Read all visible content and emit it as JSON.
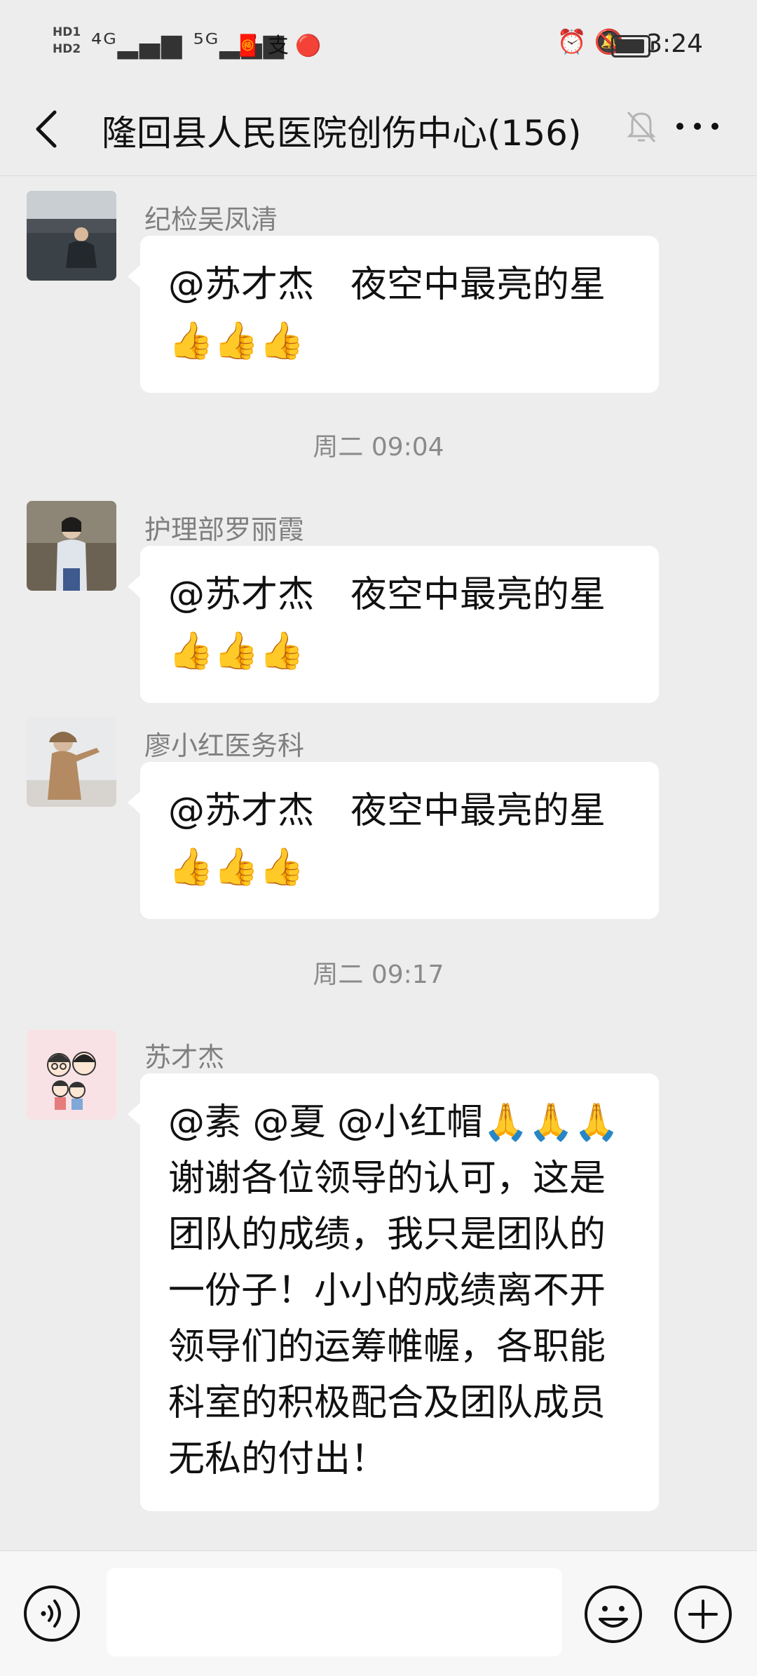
{
  "status_bar": {
    "hd_label": "HD1\nHD2",
    "signal_text": "⁴ᴳ▂▄▆ ⁵ᴳ▂▄▆ ◠",
    "app_icons": "🧧 支 🔴",
    "right_icons": "⏰ 🔕",
    "time": "3:24"
  },
  "header": {
    "title": "隆回县人民医院创伤中心(156)",
    "back_icon": "chevron-left",
    "mute_icon": "bell-off",
    "more_icon": "ellipsis"
  },
  "messages": [
    {
      "sender": "纪检吴凤清",
      "text": "@苏才杰　夜空中最亮的星👍👍👍"
    },
    {
      "timestamp": "周二 09:04"
    },
    {
      "sender": "护理部罗丽霞",
      "text": "@苏才杰　夜空中最亮的星👍👍👍"
    },
    {
      "sender": "廖小红医务科",
      "text": "@苏才杰　夜空中最亮的星👍👍👍"
    },
    {
      "timestamp": "周二 09:17"
    },
    {
      "sender": "苏才杰",
      "text": "@素  @夏  @小红帽🙏🙏🙏  谢谢各位领导的认可，这是团队的成绩，我只是团队的一份子！小小的成绩离不开领导们的运筹帷幄，各职能科室的积极配合及团队成员无私的付出！"
    }
  ],
  "input_bar": {
    "voice_icon": "voice-icon",
    "emoji_icon": "emoji-icon",
    "plus_icon": "plus-icon",
    "value": ""
  },
  "colors": {
    "background": "#ededed",
    "bubble": "#ffffff",
    "sender_text": "#7f7f7f",
    "timestamp_text": "#8a8a8a"
  }
}
